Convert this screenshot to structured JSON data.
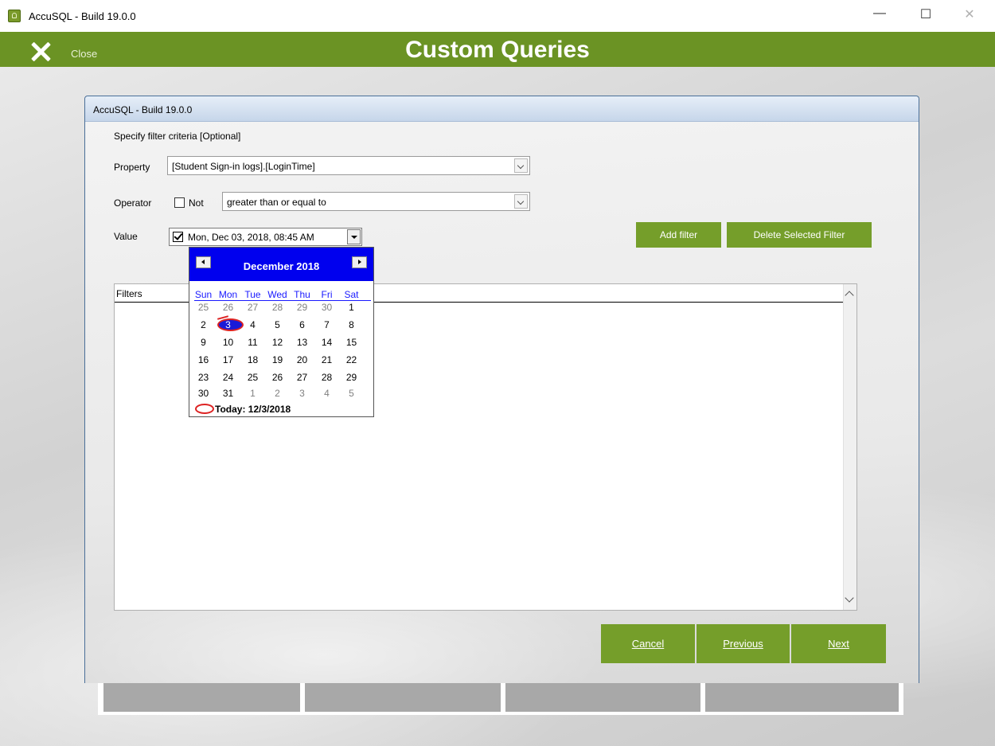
{
  "window": {
    "title": "AccuSQL - Build 19.0.0",
    "minimize": "—",
    "maximize": "☐",
    "close": "✕"
  },
  "header": {
    "close_label": "Close",
    "page_title": "Custom Queries",
    "color": "#6b9324"
  },
  "dialog": {
    "title": "AccuSQL - Build 19.0.0",
    "instruction": "Specify filter criteria [Optional]",
    "property_label": "Property",
    "property_value": "[Student Sign-in logs].[LoginTime]",
    "operator_label": "Operator",
    "not_label": "Not",
    "not_checked": false,
    "operator_value": "greater than or equal to",
    "value_label": "Value",
    "value_checked": true,
    "value_text": "Mon, Dec 03, 2018, 08:45 AM",
    "add_filter": "Add filter",
    "delete_filter": "Delete Selected Filter",
    "filters_header": "Filters"
  },
  "calendar": {
    "title": "December 2018",
    "weekdays": [
      "Sun",
      "Mon",
      "Tue",
      "Wed",
      "Thu",
      "Fri",
      "Sat"
    ],
    "weeks": [
      [
        "25",
        "26",
        "27",
        "28",
        "29",
        "30",
        "1"
      ],
      [
        "2",
        "3",
        "4",
        "5",
        "6",
        "7",
        "8"
      ],
      [
        "9",
        "10",
        "11",
        "12",
        "13",
        "14",
        "15"
      ],
      [
        "16",
        "17",
        "18",
        "19",
        "20",
        "21",
        "22"
      ],
      [
        "23",
        "24",
        "25",
        "26",
        "27",
        "28",
        "29"
      ],
      [
        "30",
        "31",
        "1",
        "2",
        "3",
        "4",
        "5"
      ]
    ],
    "selected_day": "3",
    "today": "Today: 12/3/2018",
    "header_color": "#0000ee"
  },
  "nav_buttons": {
    "cancel_label": "Cancel",
    "previous_label": "Previous",
    "next_label": "Next",
    "color": "#759e2a"
  },
  "accent": "#759e2a"
}
